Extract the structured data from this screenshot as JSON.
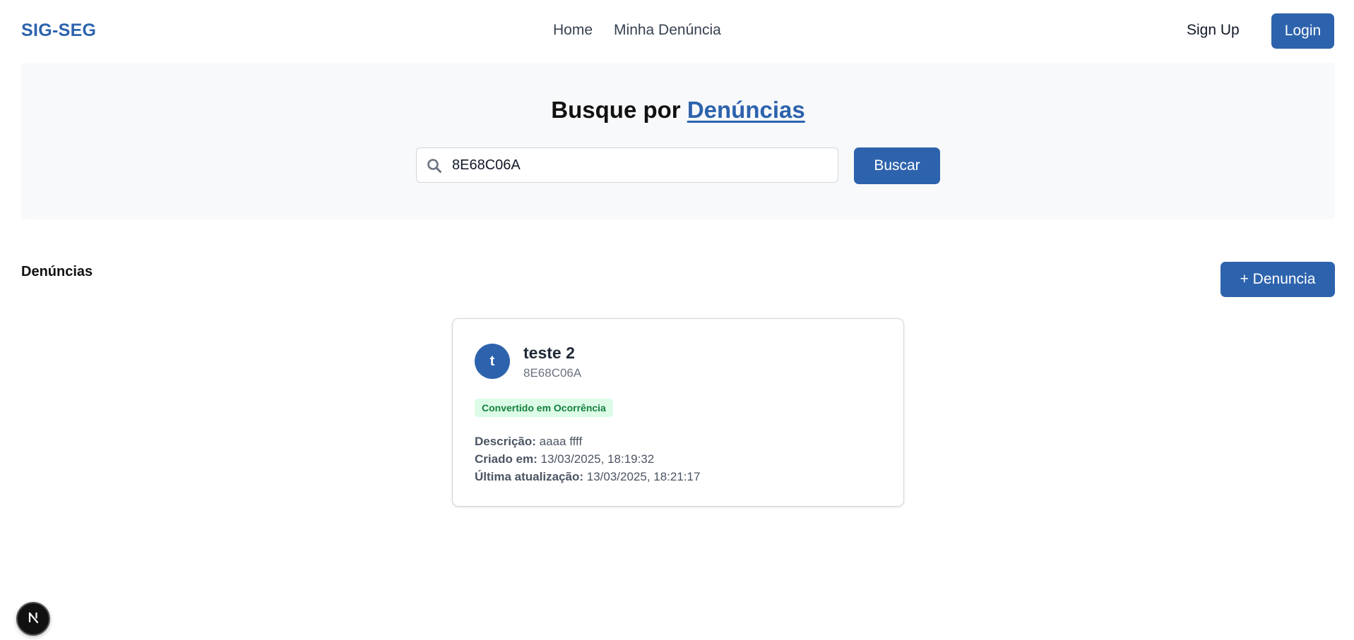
{
  "navbar": {
    "brand": "SIG-SEG",
    "links": [
      {
        "label": "Home"
      },
      {
        "label": "Minha Denúncia"
      }
    ],
    "signup_label": "Sign Up",
    "login_label": "Login"
  },
  "hero": {
    "title_prefix": "Busque por",
    "title_accent": "Denúncias",
    "search": {
      "value": "8E68C06A",
      "icon": "search-icon"
    },
    "search_button_label": "Buscar"
  },
  "section": {
    "title": "Denúncias",
    "add_button_label": "+ Denuncia"
  },
  "cards": [
    {
      "avatar_letter": "t",
      "title": "teste 2",
      "code": "8E68C06A",
      "status": "Convertido em Ocorrência",
      "description_label": "Descrição:",
      "description_value": "aaaa ffff",
      "created_label": "Criado em:",
      "created_value": "13/03/2025, 18:19:32",
      "updated_label": "Última atualização:",
      "updated_value": "13/03/2025, 18:21:17"
    }
  ],
  "dev_badge": {
    "letter": "N",
    "icon": "nextjs-icon"
  },
  "colors": {
    "primary": "#2d63ad",
    "hero_background": "#f8f9fa",
    "status_badge_background": "#dcfce7",
    "status_badge_text": "#15803d"
  }
}
